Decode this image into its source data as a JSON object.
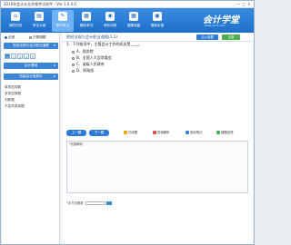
{
  "window": {
    "title": "2016年会计从业资格考试软件 - Ver 1.0.0.0",
    "controls": [
      "—",
      "□",
      "✕"
    ]
  },
  "toolbar": {
    "items": [
      {
        "label": "我的任务",
        "icon": "home-icon",
        "glyph": "⌂",
        "active": false
      },
      {
        "label": "考试大纲",
        "icon": "book-icon",
        "glyph": "▤",
        "active": false
      },
      {
        "label": "章节练习",
        "icon": "edit-icon",
        "glyph": "✎",
        "active": true
      },
      {
        "label": "模拟考试",
        "icon": "document-icon",
        "glyph": "▦",
        "active": false
      },
      {
        "label": "考前冲刺",
        "icon": "location-icon",
        "glyph": "◉",
        "active": false
      },
      {
        "label": "错题收藏",
        "icon": "grid-icon",
        "glyph": "▦",
        "active": false
      },
      {
        "label": "模拟实操",
        "icon": "excel-icon",
        "glyph": "▣",
        "active": false
      }
    ],
    "logo": {
      "text": "会计学堂",
      "sub": "www.acc5.com"
    }
  },
  "sidebar": {
    "radio_left": "全部",
    "radio_right": "只看错题",
    "section1": "财经法规与会计职业道德",
    "section2": "会计基础",
    "section3": "初级会计电算化",
    "numbers": [
      "1",
      "2",
      "3",
      "4",
      "5"
    ],
    "items": [
      "单项选择题",
      "多项选择题",
      "判断题",
      "不定项选择题"
    ]
  },
  "main": {
    "question_title": "财经法规与会计职业道德(1,1)",
    "btn_collect": "加入收藏",
    "btn_submit": "交卷",
    "question_text": "1、下列各项中，主管会计工作的机关是____。",
    "options": [
      "A、国务院",
      "B、全国人大及常委会",
      "C、省级人民政府",
      "D、财政部"
    ],
    "prev": "上一题",
    "next": "下一题",
    "actions": [
      {
        "label": "已收藏",
        "color": "#f0a500"
      },
      {
        "label": "答案解析",
        "color": "#e05050"
      },
      {
        "label": "添加笔记",
        "color": "#3b84d6"
      },
      {
        "label": "错题反馈",
        "color": "#4cae4c"
      }
    ],
    "answer_header": "*答题解析",
    "jump_label": "*本节总题数",
    "jump_btn": "GO"
  }
}
